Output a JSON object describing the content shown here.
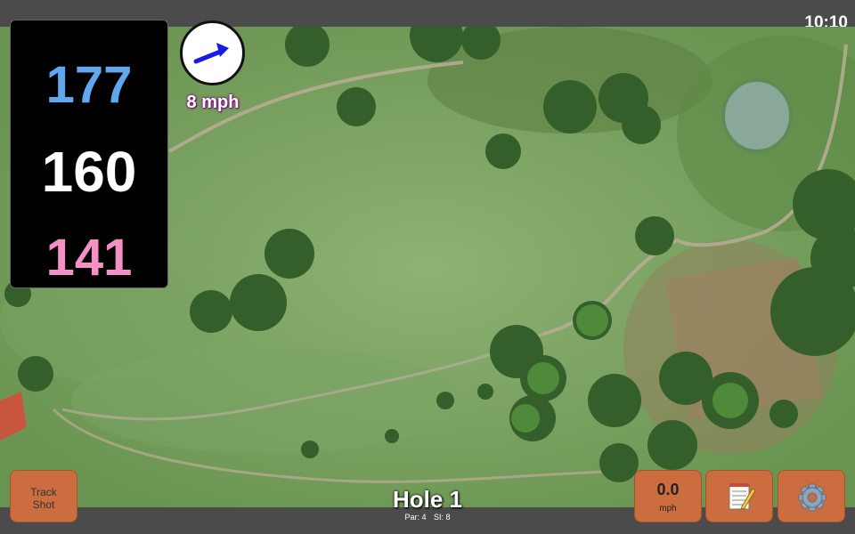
{
  "status": {
    "time": "10:10"
  },
  "distances": {
    "back": "177",
    "center": "160",
    "front": "141"
  },
  "wind": {
    "speed_label": "8 mph",
    "icon": "wind-arrow-icon",
    "direction": "east-northeast"
  },
  "hole": {
    "title": "Hole 1",
    "par": "Par: 4",
    "stroke_index": "SI: 8"
  },
  "buttons": {
    "track_shot_line1": "Track",
    "track_shot_line2": "Shot",
    "speed_value": "0.0",
    "speed_unit": "mph",
    "notes_icon": "notepad-icon",
    "settings_icon": "gear-icon"
  },
  "colors": {
    "back_distance": "#5fa8f0",
    "center_distance": "#ffffff",
    "front_distance": "#f590c6",
    "button": "#cb6d3f",
    "wind_arrow": "#1a1ae6"
  }
}
